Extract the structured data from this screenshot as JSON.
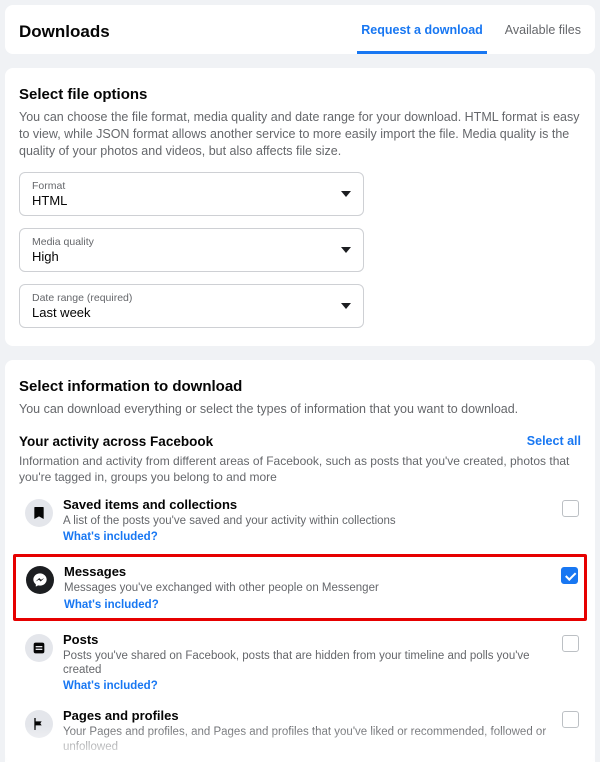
{
  "header": {
    "title": "Downloads",
    "tabs": {
      "request": "Request a download",
      "available": "Available files"
    }
  },
  "fileOptions": {
    "heading": "Select file options",
    "desc": "You can choose the file format, media quality and date range for your download. HTML format is easy to view, while JSON format allows another service to more easily import the file. Media quality is the quality of your photos and videos, but also affects file size.",
    "format": {
      "label": "Format",
      "value": "HTML"
    },
    "media": {
      "label": "Media quality",
      "value": "High"
    },
    "dateRange": {
      "label": "Date range (required)",
      "value": "Last week"
    }
  },
  "info": {
    "heading": "Select information to download",
    "desc": "You can download everything or select the types of information that you want to download.",
    "activity": {
      "heading": "Your activity across Facebook",
      "selectAll": "Select all",
      "desc": "Information and activity from different areas of Facebook, such as posts that you've created, photos that you're tagged in, groups you belong to and more"
    },
    "items": {
      "saved": {
        "title": "Saved items and collections",
        "sub": "A list of the posts you've saved and your activity within collections",
        "link": "What's included?"
      },
      "messages": {
        "title": "Messages",
        "sub": "Messages you've exchanged with other people on Messenger",
        "link": "What's included?"
      },
      "posts": {
        "title": "Posts",
        "sub": "Posts you've shared on Facebook, posts that are hidden from your timeline and polls you've created",
        "link": "What's included?"
      },
      "pages": {
        "title": "Pages and profiles",
        "sub": "Your Pages and profiles, and Pages and profiles that you've liked or recommended, followed or unfollowed"
      }
    }
  }
}
